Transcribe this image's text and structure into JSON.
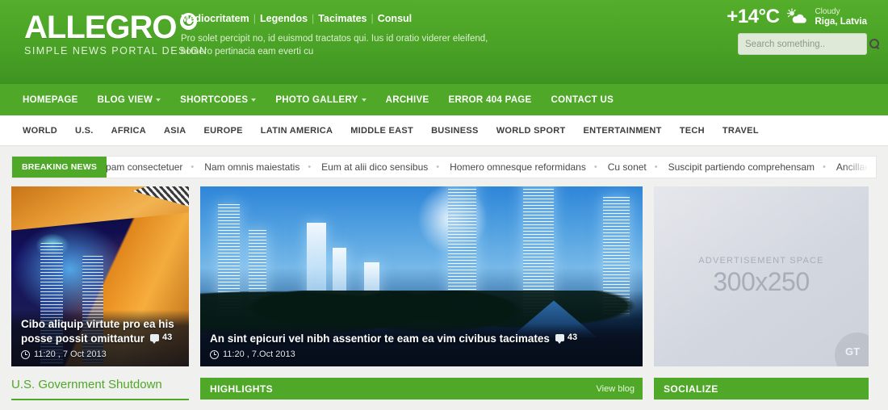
{
  "header": {
    "logo": {
      "word": "ALLEGRO",
      "tagline": "SIMPLE NEWS PORTAL DESIGN",
      "mark_icon": "spiral-logo-icon"
    },
    "top_links": [
      "Mediocritatem",
      "Legendos",
      "Tacimates",
      "Consul"
    ],
    "description": "Pro solet percipit no, id euismod tractatos qui. Ius id oratio viderer eleifend, homero pertinacia eam everti cu",
    "weather": {
      "temperature": "+14°C",
      "condition": "Cloudy",
      "location": "Riga, Latvia",
      "icon": "sun-behind-cloud-icon"
    },
    "search": {
      "placeholder": "Search something..",
      "value": "",
      "icon": "search-icon"
    }
  },
  "main_nav": [
    {
      "label": "HOMEPAGE",
      "has_dropdown": false
    },
    {
      "label": "BLOG VIEW",
      "has_dropdown": true
    },
    {
      "label": "SHORTCODES",
      "has_dropdown": true
    },
    {
      "label": "PHOTO GALLERY",
      "has_dropdown": true
    },
    {
      "label": "ARCHIVE",
      "has_dropdown": false
    },
    {
      "label": "ERROR 404 PAGE",
      "has_dropdown": false
    },
    {
      "label": "CONTACT US",
      "has_dropdown": false
    }
  ],
  "sub_nav": [
    "WORLD",
    "U.S.",
    "AFRICA",
    "ASIA",
    "EUROPE",
    "LATIN AMERICA",
    "MIDDLE EAST",
    "BUSINESS",
    "WORLD SPORT",
    "ENTERTAINMENT",
    "TECH",
    "TRAVEL"
  ],
  "breaking": {
    "label": "BREAKING NEWS",
    "items": [
      "pam consectetuer",
      "Nam omnis maiestatis",
      "Eum at alii dico sensibus",
      "Homero omnesque reformidans",
      "Cu sonet",
      "Suscipit partiendo comprehensam",
      "Ancillae antiopam co"
    ],
    "separator": "•"
  },
  "featured": {
    "left": {
      "title": "Cibo aliquip virtute pro ea his posse possit omittantur",
      "comments": "43",
      "timestamp": "11:20 , 7 Oct 2013",
      "comment_icon": "comment-bubble-icon",
      "time_icon": "clock-icon"
    },
    "center": {
      "title": "An sint epicuri vel nibh assentior te eam ea vim civibus tacimates",
      "comments": "43",
      "timestamp": "11:20 , 7.Oct 2013",
      "comment_icon": "comment-bubble-icon",
      "time_icon": "clock-icon"
    },
    "ad": {
      "label": "ADVERTISEMENT SPACE",
      "size": "300x250",
      "watermark": "GT"
    }
  },
  "bottom": {
    "left_section_title": "U.S. Government Shutdown",
    "highlights": {
      "title": "HIGHLIGHTS",
      "link": "View blog"
    },
    "socialize": {
      "title": "SOCIALIZE"
    }
  },
  "colors": {
    "brand_green": "#4fa828",
    "header_green_top": "#54ae2b",
    "header_green_bottom": "#3f9421",
    "page_bg": "#f0f0ee"
  }
}
